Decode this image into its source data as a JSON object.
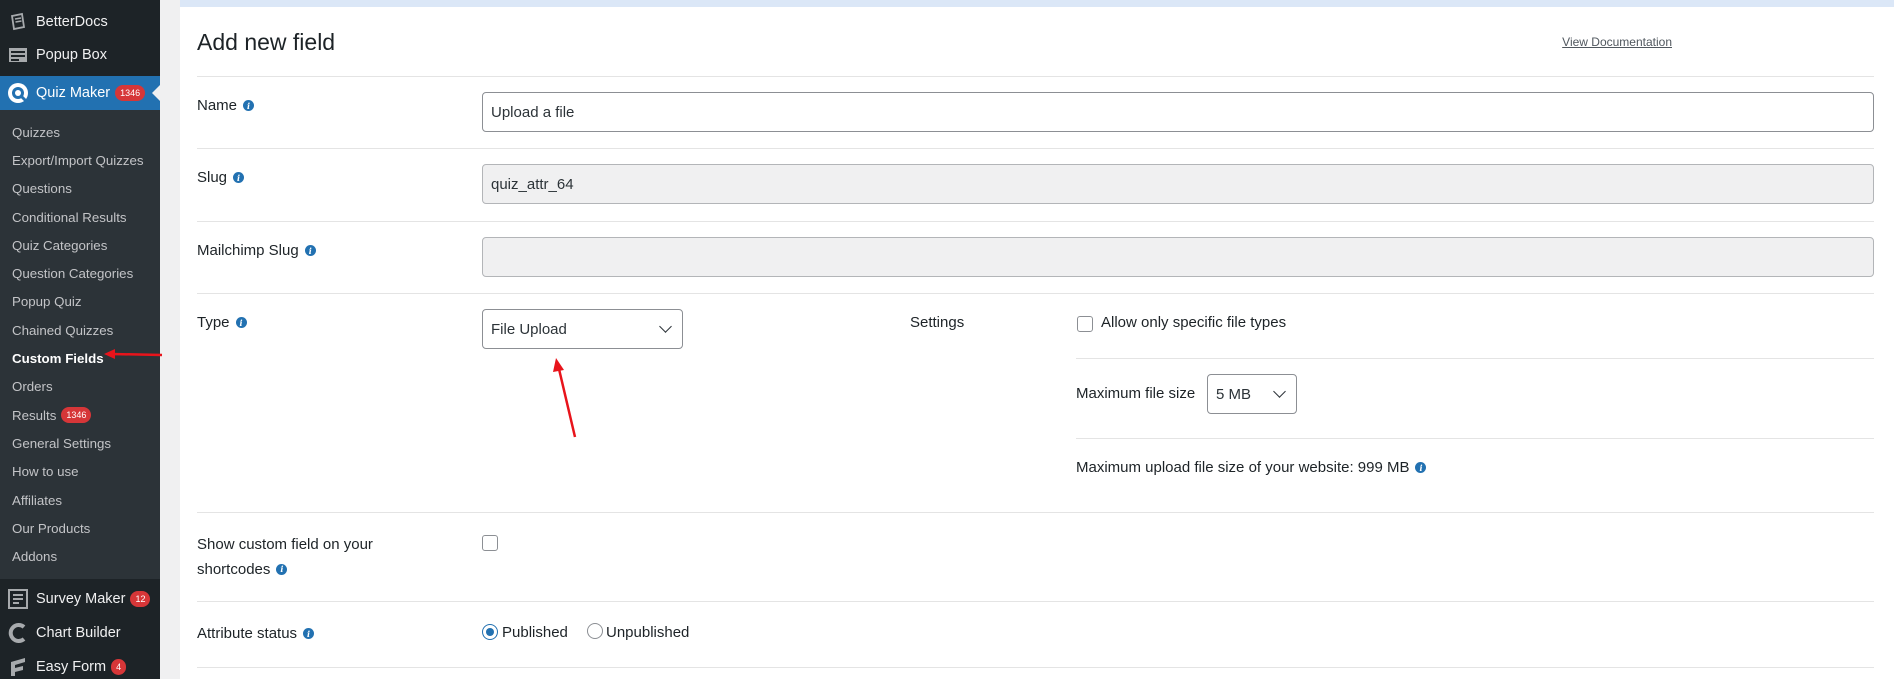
{
  "sidebar": {
    "top_items": [
      {
        "label": "BetterDocs",
        "icon": "betterdocs-icon"
      },
      {
        "label": "Popup Box",
        "icon": "popup-box-icon"
      }
    ],
    "current": {
      "label": "Quiz Maker",
      "badge": "1346",
      "icon": "quiz-maker-icon"
    },
    "submenu": [
      {
        "label": "Quizzes"
      },
      {
        "label": "Export/Import Quizzes"
      },
      {
        "label": "Questions"
      },
      {
        "label": "Conditional Results"
      },
      {
        "label": "Quiz Categories"
      },
      {
        "label": "Question Categories"
      },
      {
        "label": "Popup Quiz"
      },
      {
        "label": "Chained Quizzes"
      },
      {
        "label": "Custom Fields",
        "active": true
      },
      {
        "label": "Orders"
      },
      {
        "label": "Results",
        "badge": "1346"
      },
      {
        "label": "General Settings"
      },
      {
        "label": "How to use"
      },
      {
        "label": "Affiliates"
      },
      {
        "label": "Our Products"
      },
      {
        "label": "Addons"
      }
    ],
    "bottom_items": [
      {
        "label": "Survey Maker",
        "badge": "12",
        "icon": "survey-maker-icon"
      },
      {
        "label": "Chart Builder",
        "icon": "chart-builder-icon"
      },
      {
        "label": "Easy Form",
        "badge": "4",
        "icon": "easy-form-icon"
      }
    ]
  },
  "page": {
    "title": "Add new field",
    "doc_link": "View Documentation"
  },
  "form": {
    "name_label": "Name",
    "name_value": "Upload a file",
    "slug_label": "Slug",
    "slug_value": "quiz_attr_64",
    "mailchimp_label": "Mailchimp Slug",
    "mailchimp_value": "",
    "type_label": "Type",
    "type_value": "File Upload",
    "settings_label": "Settings",
    "allow_types_label": "Allow only specific file types",
    "max_size_label": "Maximum file size",
    "max_size_value": "5 MB",
    "max_upload_text": "Maximum upload file size of your website: 999 MB",
    "show_field_label_line1": "Show custom field on your",
    "show_field_label_line2": "shortcodes",
    "status_label": "Attribute status",
    "status_published": "Published",
    "status_unpublished": "Unpublished"
  },
  "colors": {
    "accent": "#2271b1",
    "sidebar_bg": "#1d2327",
    "badge": "#d63638",
    "annotation_arrow": "#e8141b"
  }
}
